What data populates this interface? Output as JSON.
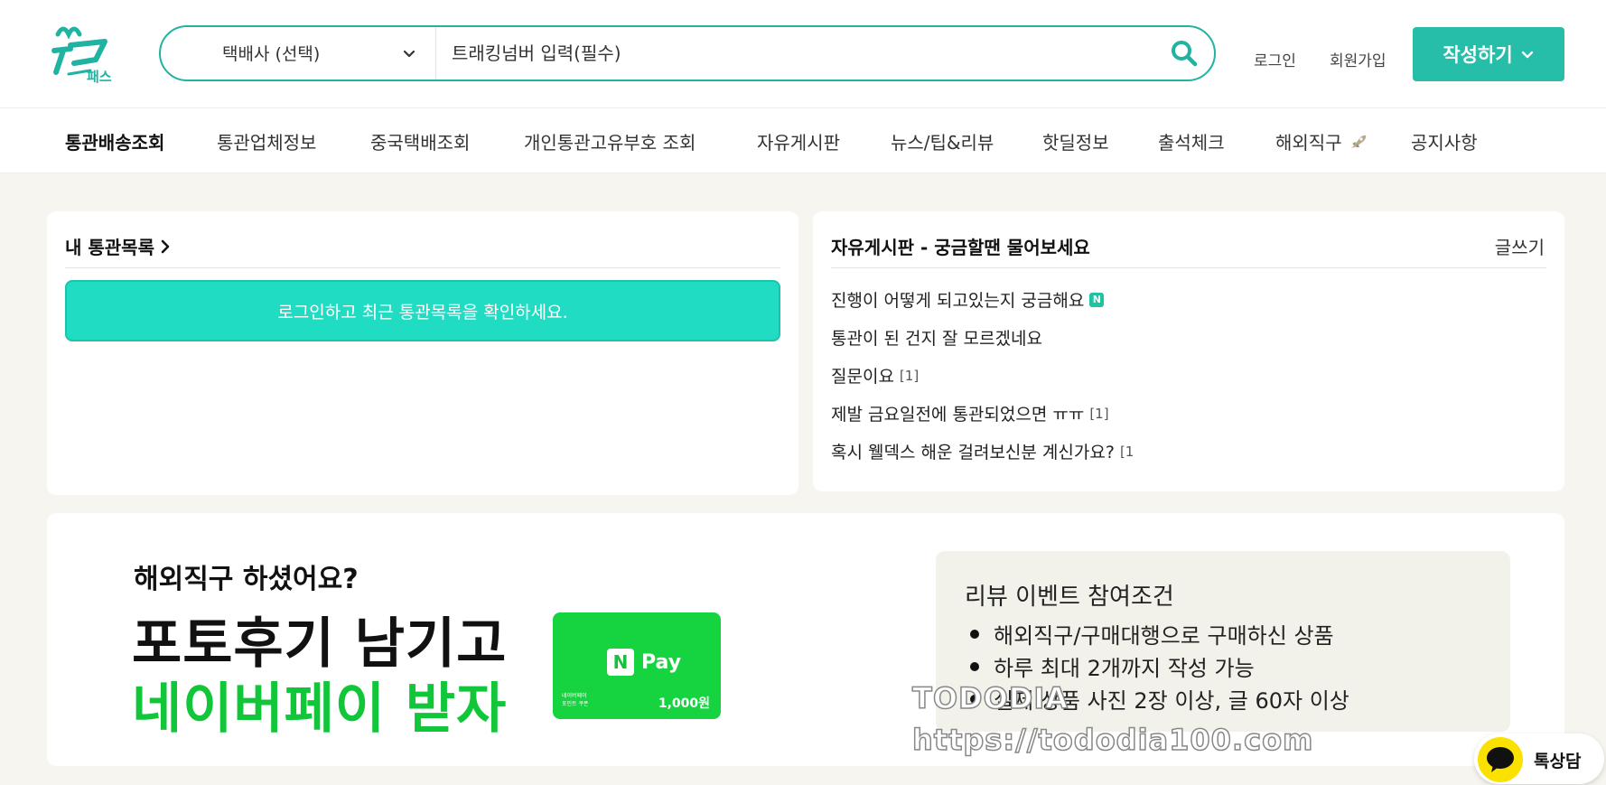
{
  "header": {
    "logo_text": "패스",
    "carrier_select": "택배사 (선택)",
    "tracking_placeholder": "트래킹넘버 입력(필수)",
    "login": "로그인",
    "signup": "회원가입",
    "write_button": "작성하기"
  },
  "nav": {
    "items": [
      {
        "label": "통관배송조회"
      },
      {
        "label": "통관업체정보"
      },
      {
        "label": "중국택배조회"
      },
      {
        "label": "개인통관고유부호 조회"
      },
      {
        "label": "자유게시판"
      },
      {
        "label": "뉴스/팁&리뷰"
      },
      {
        "label": "핫딜정보"
      },
      {
        "label": "출석체크"
      },
      {
        "label": "해외직구"
      },
      {
        "label": "공지사항"
      }
    ]
  },
  "customs_panel": {
    "title": "내 통관목록",
    "login_prompt": "로그인하고 최근 통관목록을 확인하세요."
  },
  "board_panel": {
    "title": "자유게시판 - 궁금할땐 물어보세요",
    "write_link": "글쓰기",
    "posts": [
      {
        "title": "진행이 어떻게 되고있는지 궁금해요",
        "count": "",
        "new_badge": "N"
      },
      {
        "title": "통관이 된 건지 잘 모르겠네요",
        "count": "",
        "new_badge": ""
      },
      {
        "title": "질문이요",
        "count": "[1]",
        "new_badge": ""
      },
      {
        "title": "제발 금요일전에 통관되었으면 ㅠㅠ",
        "count": "[1]",
        "new_badge": ""
      },
      {
        "title": "혹시 웰덱스 해운 걸려보신분 계신가요?",
        "count": "[1",
        "new_badge": ""
      }
    ]
  },
  "banner": {
    "question": "해외직구 하셨어요?",
    "line1": "포토후기 남기고",
    "line2": "네이버페이 받자",
    "npay_logo": "Pay",
    "npay_n": "N",
    "npay_small": "네이버페이\n포인트 쿠폰",
    "npay_amount": "1,000원",
    "conditions_title": "리뷰 이벤트 참여조건",
    "conditions": [
      "해외직구/구매대행으로 구매하신 상품",
      "하루 최대 2개까지 작성 가능",
      "실제 상품 사진 2장 이상, 글 60자 이상"
    ]
  },
  "watermark": {
    "name": "TODODIA",
    "url": "https://tododia100.com"
  },
  "chat": {
    "label": "톡상담"
  },
  "colors": {
    "brand": "#26bda9",
    "banner_teal": "#1fdcc3",
    "naver_green": "#16d43f",
    "kakao_yellow": "#fae100"
  }
}
